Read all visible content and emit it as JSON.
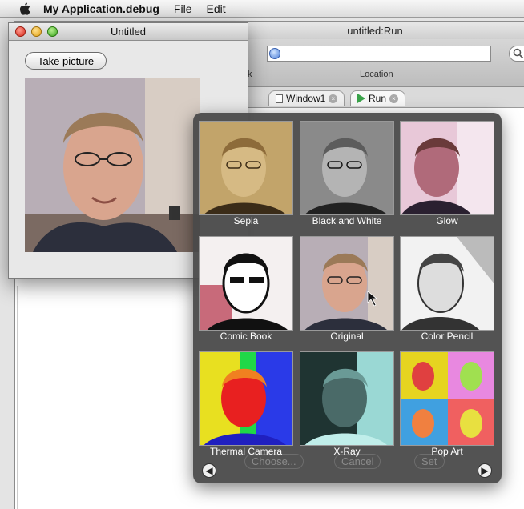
{
  "menubar": {
    "app_name": "My Application.debug",
    "menus": [
      "File",
      "Edit"
    ]
  },
  "run_window": {
    "title": "untitled:Run",
    "location_label": "Location",
    "toolbar_partial_label": "k",
    "tabs": [
      {
        "label": "Window1",
        "icon": "window-doc-icon"
      },
      {
        "label": "Run",
        "icon": "play-icon"
      }
    ]
  },
  "untitled_window": {
    "title": "Untitled",
    "take_picture_label": "Take picture"
  },
  "effects": {
    "items": [
      {
        "label": "Sepia"
      },
      {
        "label": "Black and White"
      },
      {
        "label": "Glow"
      },
      {
        "label": "Comic Book"
      },
      {
        "label": "Original"
      },
      {
        "label": "Color Pencil"
      },
      {
        "label": "Thermal Camera"
      },
      {
        "label": "X-Ray"
      },
      {
        "label": "Pop Art"
      }
    ],
    "prev_icon": "arrow-left-icon",
    "next_icon": "arrow-right-icon",
    "background_buttons": [
      "Choose...",
      "Cancel",
      "Set"
    ]
  }
}
